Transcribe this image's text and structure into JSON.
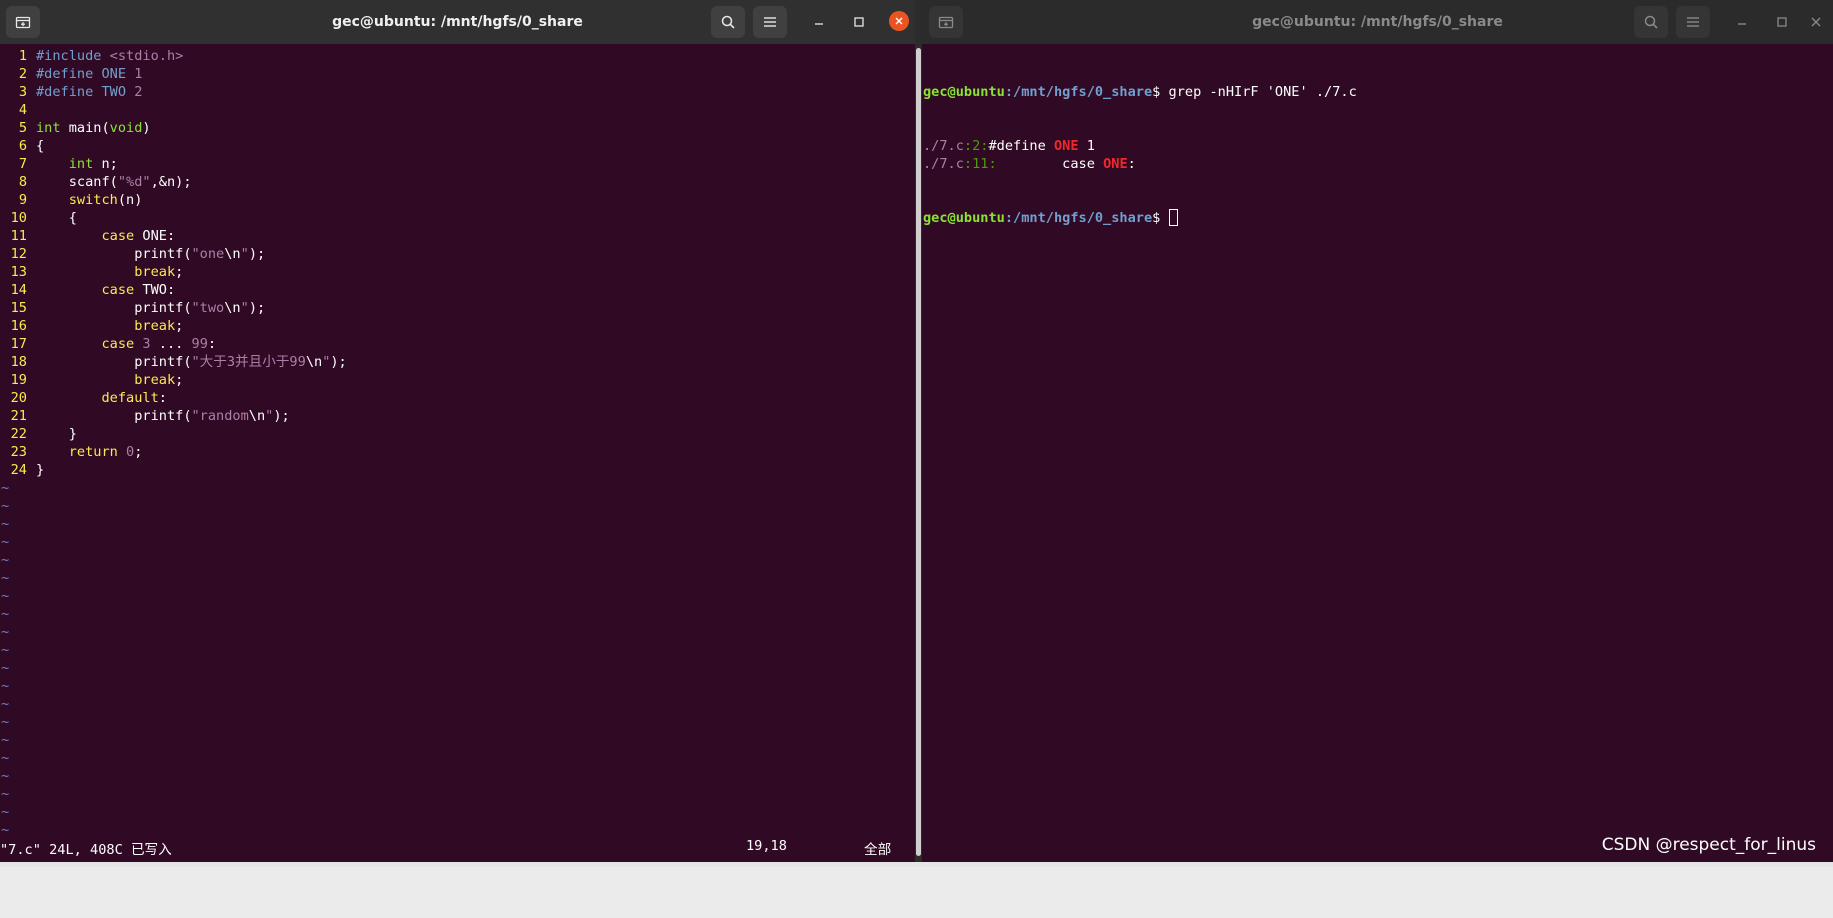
{
  "left_window": {
    "title": "gec@ubuntu: /mnt/hgfs/0_share",
    "editor": {
      "lines": [
        [
          {
            "t": "#include ",
            "c": "pp"
          },
          {
            "t": "<stdio.h>",
            "c": "cn"
          }
        ],
        [
          {
            "t": "#define ",
            "c": "pp"
          },
          {
            "t": "ONE ",
            "c": "pp"
          },
          {
            "t": "1",
            "c": "cn"
          }
        ],
        [
          {
            "t": "#define ",
            "c": "pp"
          },
          {
            "t": "TWO ",
            "c": "pp"
          },
          {
            "t": "2",
            "c": "cn"
          }
        ],
        [],
        [
          {
            "t": "int",
            "c": "ty"
          },
          {
            "t": " main("
          },
          {
            "t": "void",
            "c": "ty"
          },
          {
            "t": ")"
          }
        ],
        [
          {
            "t": "{"
          }
        ],
        [
          {
            "t": "    "
          },
          {
            "t": "int",
            "c": "ty"
          },
          {
            "t": " n;"
          }
        ],
        [
          {
            "t": "    scanf("
          },
          {
            "t": "\"%d\"",
            "c": "cn"
          },
          {
            "t": ",&n);"
          }
        ],
        [
          {
            "t": "    "
          },
          {
            "t": "switch",
            "c": "kw"
          },
          {
            "t": "(n)"
          }
        ],
        [
          {
            "t": "    {"
          }
        ],
        [
          {
            "t": "        "
          },
          {
            "t": "case",
            "c": "kw"
          },
          {
            "t": " ONE:"
          }
        ],
        [
          {
            "t": "            printf("
          },
          {
            "t": "\"one",
            "c": "cn"
          },
          {
            "t": "\\n"
          },
          {
            "t": "\"",
            "c": "cn"
          },
          {
            "t": ");"
          }
        ],
        [
          {
            "t": "            "
          },
          {
            "t": "break",
            "c": "kw"
          },
          {
            "t": ";"
          }
        ],
        [
          {
            "t": "        "
          },
          {
            "t": "case",
            "c": "kw"
          },
          {
            "t": " TWO:"
          }
        ],
        [
          {
            "t": "            printf("
          },
          {
            "t": "\"two",
            "c": "cn"
          },
          {
            "t": "\\n"
          },
          {
            "t": "\"",
            "c": "cn"
          },
          {
            "t": ");"
          }
        ],
        [
          {
            "t": "            "
          },
          {
            "t": "break",
            "c": "kw"
          },
          {
            "t": ";"
          }
        ],
        [
          {
            "t": "        "
          },
          {
            "t": "case",
            "c": "kw"
          },
          {
            "t": " "
          },
          {
            "t": "3",
            "c": "cn"
          },
          {
            "t": " ... "
          },
          {
            "t": "99",
            "c": "cn"
          },
          {
            "t": ":"
          }
        ],
        [
          {
            "t": "            printf("
          },
          {
            "t": "\"大于3并且小于99",
            "c": "cn"
          },
          {
            "t": "\\n"
          },
          {
            "t": "\"",
            "c": "cn"
          },
          {
            "t": ");"
          }
        ],
        [
          {
            "t": "            "
          },
          {
            "t": "break",
            "c": "kw"
          },
          {
            "t": ";"
          }
        ],
        [
          {
            "t": "        "
          },
          {
            "t": "default",
            "c": "kw"
          },
          {
            "t": ":"
          }
        ],
        [
          {
            "t": "            printf("
          },
          {
            "t": "\"random",
            "c": "cn"
          },
          {
            "t": "\\n"
          },
          {
            "t": "\"",
            "c": "cn"
          },
          {
            "t": ");"
          }
        ],
        [
          {
            "t": "    }"
          }
        ],
        [
          {
            "t": "    "
          },
          {
            "t": "return",
            "c": "kw"
          },
          {
            "t": " "
          },
          {
            "t": "0",
            "c": "cn"
          },
          {
            "t": ";"
          }
        ],
        [
          {
            "t": "}"
          }
        ]
      ],
      "tilde_count": 20,
      "tilde_char": "~"
    },
    "status": {
      "file_info": "\"7.c\" 24L, 408C 已写入",
      "position": "19,18",
      "scroll": "全部"
    }
  },
  "right_window": {
    "title": "gec@ubuntu: /mnt/hgfs/0_share",
    "terminal": {
      "user_host": "gec@ubuntu",
      "cwd": "/mnt/hgfs/0_share",
      "prompt_symbol": "$",
      "command": " grep -nHIrF 'ONE' ./7.c",
      "results": [
        {
          "file": "./7.c",
          "line": "2",
          "pre": "#define ",
          "match": "ONE",
          "post": " 1"
        },
        {
          "file": "./7.c",
          "line": "11",
          "pre": "        case ",
          "match": "ONE",
          "post": ":"
        }
      ]
    }
  },
  "watermark": "CSDN @respect_for_linus",
  "colors": {
    "terminal_bg": "#300a24",
    "titlebar_bg": "#303030",
    "close_button": "#e95420",
    "line_number": "#fce94f"
  }
}
